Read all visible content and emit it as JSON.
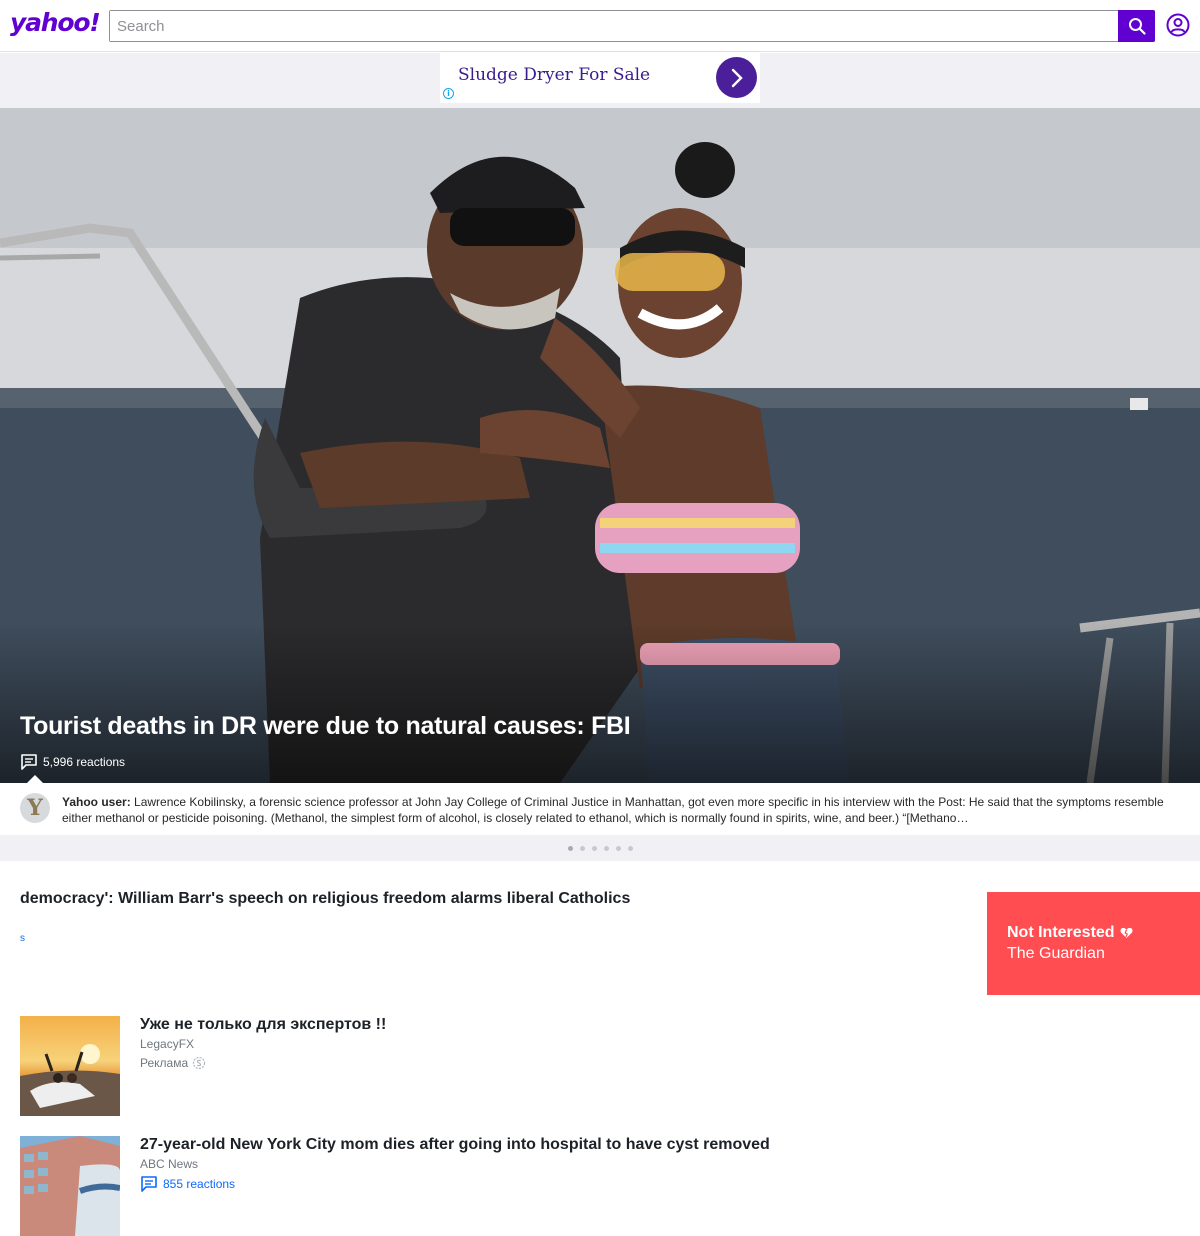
{
  "header": {
    "logo": "yahoo!",
    "search_placeholder": "Search"
  },
  "ad_banner": {
    "text": "Sludge Dryer For Sale",
    "info_glyph": "i"
  },
  "hero": {
    "title": "Tourist deaths in DR were due to natural causes: FBI",
    "reactions": "5,996 reactions"
  },
  "comment": {
    "author": "Yahoo user:",
    "avatar_letter": "Y",
    "text": "Lawrence Kobilinsky, a forensic science professor at John Jay College of Criminal Justice in Manhattan, got even more specific in his interview with the Post: He said that the symptoms resemble either methanol or pesticide poisoning. (Methanol, the simplest form of alcohol, is closely related to ethanol, which is normally found in spirits, wine, and beer.) “[Methano…"
  },
  "carousel": {
    "count": 6,
    "active_index": 0
  },
  "swiped_card": {
    "title": "democracy': William Barr's speech on religious freedom alarms liberal Catholics",
    "sub": "s"
  },
  "not_interested": {
    "label": "Not Interested",
    "source": "The Guardian"
  },
  "stream": [
    {
      "title": "Уже не только для экспертов !!",
      "source": "LegacyFX",
      "meta": "Реклама"
    },
    {
      "title": "27-year-old New York City mom dies after going into hospital to have cyst removed",
      "source": "ABC News",
      "reactions": "855 reactions"
    }
  ],
  "colors": {
    "brand": "#6001d2",
    "link": "#0f69ff",
    "not_interested_bg": "#ff4d52"
  }
}
